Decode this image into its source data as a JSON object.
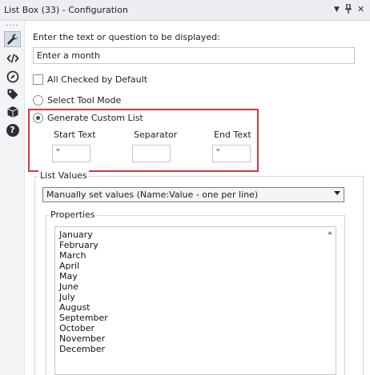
{
  "window": {
    "title": "List Box (33) - Configuration",
    "controls": {
      "dropdown_glyph": "▼",
      "pin_glyph": "⊥",
      "close_glyph": "✕"
    }
  },
  "sidebar": {
    "dots": "····",
    "icons": [
      "wrench-icon",
      "code-icon",
      "compass-icon",
      "tag-icon",
      "box-icon",
      "help-icon"
    ],
    "help_glyph": "?"
  },
  "config": {
    "prompt_label": "Enter the text or question to be displayed:",
    "prompt_value": "Enter a month",
    "all_checked_label": "All Checked by Default",
    "select_tool_mode_label": "Select Tool Mode",
    "custom_list_label": "Generate Custom List",
    "start_text_label": "Start Text",
    "start_text_value": "\"",
    "separator_label": "Separator",
    "separator_value": "",
    "end_text_label": "End Text",
    "end_text_value": "\""
  },
  "list_values": {
    "group_label": "List Values",
    "dropdown_value": "Manually set values (Name:Value - one per line)",
    "properties_label": "Properties",
    "months": [
      "January",
      "February",
      "March",
      "April",
      "May",
      "June",
      "July",
      "August",
      "September",
      "October",
      "November",
      "December"
    ]
  },
  "colors": {
    "highlight": "#d9363e",
    "accent": "#1f4f9a"
  }
}
